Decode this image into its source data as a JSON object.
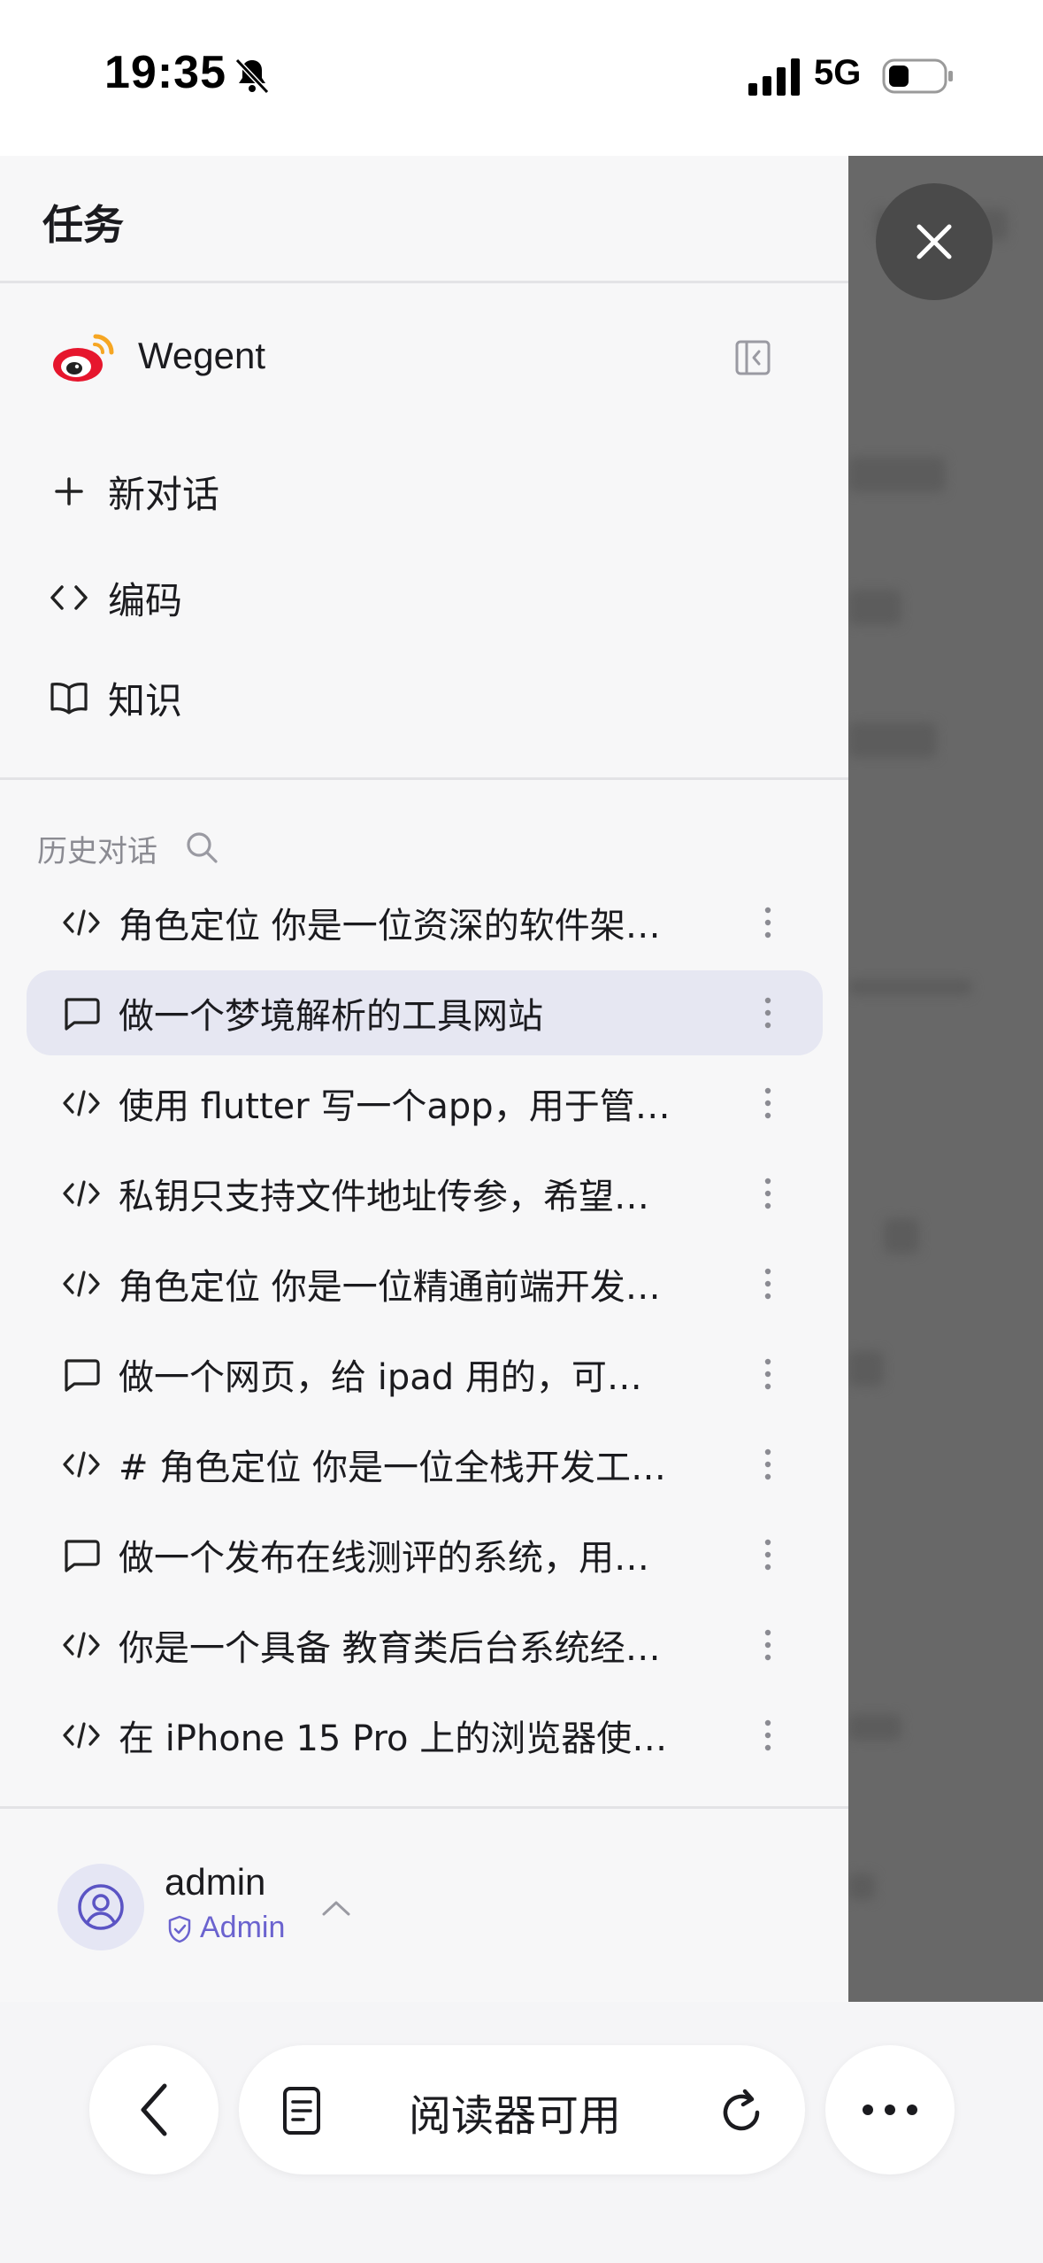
{
  "status": {
    "time": "19:35",
    "network": "5G",
    "icons": [
      "bell-slash-icon",
      "signal-icon",
      "battery-icon"
    ]
  },
  "sidebar": {
    "title": "任务",
    "brand": "Wegent",
    "nav": [
      {
        "label": "新对话",
        "icon": "plus-icon"
      },
      {
        "label": "编码",
        "icon": "code-icon"
      },
      {
        "label": "知识",
        "icon": "book-icon"
      }
    ],
    "history_title": "历史对话",
    "history": [
      {
        "text": "角色定位 你是一位资深的软件架…",
        "icon": "code-icon",
        "active": false
      },
      {
        "text": "做一个梦境解析的工具网站",
        "icon": "chat-icon",
        "active": true
      },
      {
        "text": "使用 flutter 写一个app，用于管…",
        "icon": "code-icon",
        "active": false
      },
      {
        "text": "私钥只支持文件地址传参，希望…",
        "icon": "code-icon",
        "active": false
      },
      {
        "text": "角色定位 你是一位精通前端开发…",
        "icon": "code-icon",
        "active": false
      },
      {
        "text": "做一个网页，给 ipad 用的，可…",
        "icon": "chat-icon",
        "active": false
      },
      {
        "text": "# 角色定位 你是一位全栈开发工…",
        "icon": "code-icon",
        "active": false
      },
      {
        "text": "做一个发布在线测评的系统，用…",
        "icon": "chat-icon",
        "active": false
      },
      {
        "text": "你是一个具备 教育类后台系统经…",
        "icon": "code-icon",
        "active": false
      },
      {
        "text": "在 iPhone 15 Pro 上的浏览器使…",
        "icon": "code-icon",
        "active": false
      }
    ],
    "user": {
      "name": "admin",
      "role": "Admin"
    }
  },
  "browser": {
    "reader_label": "阅读器可用"
  },
  "colors": {
    "accent": "#6b63cf",
    "active_row": "#e6e7f2",
    "overlay": "#686868",
    "sidebar_bg": "#f7f7f8"
  }
}
